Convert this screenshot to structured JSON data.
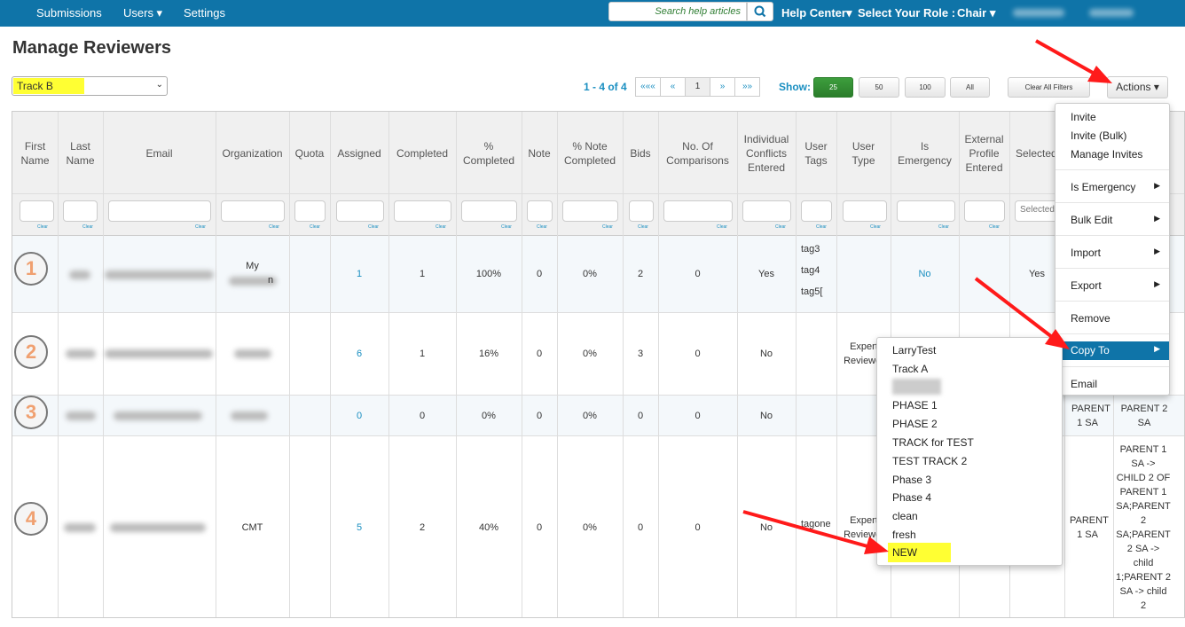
{
  "nav": {
    "submissions": "Submissions",
    "users": "Users ▾",
    "settings": "Settings",
    "search_placeholder": "Search help articles",
    "help_center": "Help Center▾",
    "role_label": "Select Your Role :",
    "role_value": "Chair ▾"
  },
  "page": {
    "title": "Manage Reviewers",
    "track_selected": "Track B"
  },
  "pager": {
    "info": "1 - 4 of 4",
    "buttons": [
      "«««",
      "«",
      "1",
      "»",
      "»»"
    ],
    "show_label": "Show:",
    "sizes": [
      "25",
      "50",
      "100",
      "All"
    ],
    "clear_filters": "Clear All Filters",
    "actions": "Actions ▾"
  },
  "columns": [
    "First Name",
    "Last Name",
    "Email",
    "Organization",
    "Quota",
    "Assigned",
    "Completed",
    "% Completed",
    "Note",
    "% Note Completed",
    "Bids",
    "No. Of Comparisons",
    "Individual Conflicts Entered",
    "User Tags",
    "User Type",
    "Is Emergency",
    "External Profile Entered",
    "Selected"
  ],
  "filter": {
    "clear": "Clear",
    "selected_placeholder": "Selected"
  },
  "rows": [
    {
      "num": "1",
      "org": "My",
      "org2": "n",
      "assigned": "1",
      "completed": "1",
      "pct": "100%",
      "note": "0",
      "note_pct": "0%",
      "bids": "2",
      "comparisons": "0",
      "conflicts": "Yes",
      "tags": [
        "tag3",
        "tag4",
        "tag5["
      ],
      "user_type": "",
      "emergency": "No",
      "selected": "Yes"
    },
    {
      "num": "2",
      "org": "",
      "assigned": "6",
      "completed": "1",
      "pct": "16%",
      "note": "0",
      "note_pct": "0%",
      "bids": "3",
      "comparisons": "0",
      "conflicts": "No",
      "tags": [],
      "user_type": "Expert Reviewer"
    },
    {
      "num": "3",
      "org": "",
      "assigned": "0",
      "completed": "0",
      "pct": "0%",
      "note": "0",
      "note_pct": "0%",
      "bids": "0",
      "comparisons": "0",
      "conflicts": "No",
      "tags": [],
      "user_type": "",
      "extra1": "PARENT 1 SA",
      "extra2": "PARENT 2 SA"
    },
    {
      "num": "4",
      "org": "CMT",
      "assigned": "5",
      "completed": "2",
      "pct": "40%",
      "note": "0",
      "note_pct": "0%",
      "bids": "0",
      "comparisons": "0",
      "conflicts": "No",
      "tags": [
        "tagone"
      ],
      "user_type": "Expert Reviewer",
      "extra1": "PARENT 1 SA",
      "extra2": "PARENT 1 SA -> CHILD 2 OF PARENT 1 SA;PARENT 2 SA;PARENT 2 SA -> child 1;PARENT 2 SA -> child 2"
    }
  ],
  "actions_menu": {
    "invite": "Invite",
    "invite_bulk": "Invite (Bulk)",
    "manage_invites": "Manage Invites",
    "is_emergency": "Is Emergency",
    "bulk_edit": "Bulk Edit",
    "import": "Import",
    "export": "Export",
    "remove": "Remove",
    "copy_to": "Copy To",
    "email": "Email"
  },
  "copy_to_menu": [
    "LarryTest",
    "Track A",
    "",
    "PHASE 1",
    "PHASE 2",
    "TRACK for TEST",
    "TEST TRACK 2",
    "Phase 3",
    "Phase 4",
    "clean",
    "fresh",
    "NEW"
  ],
  "colors": {
    "nav": "#0f74a8",
    "link": "#1a8fc1",
    "highlight": "#ffff33",
    "arrow": "#ff1a1a",
    "green": "#2b7d2b"
  }
}
